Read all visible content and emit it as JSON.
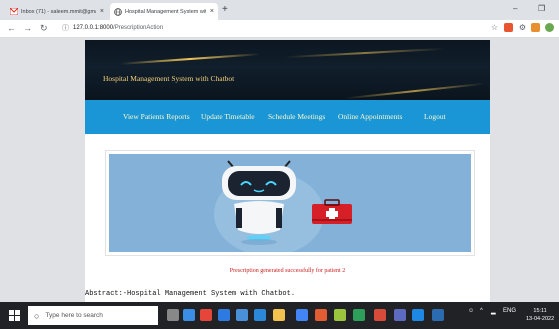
{
  "browser": {
    "tabs": [
      {
        "title": "Inbox (71) - saleem.mmit@gmail...",
        "icon": "gmail-icon"
      },
      {
        "title": "Hospital Management System with...",
        "icon": "globe-icon"
      }
    ],
    "new_tab": "+",
    "url": {
      "host": "127.0.0.1:8000",
      "path": "/PrescriptionAction"
    }
  },
  "site": {
    "title": "Hospital Management System with Chatbot",
    "nav": [
      "View Patients Reports",
      "Update Timetable",
      "Schedule Meetings",
      "Online Appointments",
      "Logout"
    ],
    "status_message": "Prescription generated successfully for patient 2",
    "abstract": "Abstract:-Hospital Management System with Chatbot."
  },
  "taskbar": {
    "search_placeholder": "Type here to search",
    "time": "15:11",
    "date": "13-04-2022",
    "lang": "ENG"
  },
  "colors": {
    "banner": "#0b1620",
    "banner_title": "#f4d27a",
    "nav_bar": "#1a95d5",
    "nav_text": "#fff8c8",
    "status_text": "#cc2222",
    "hero_bg": "#84b1d8"
  }
}
